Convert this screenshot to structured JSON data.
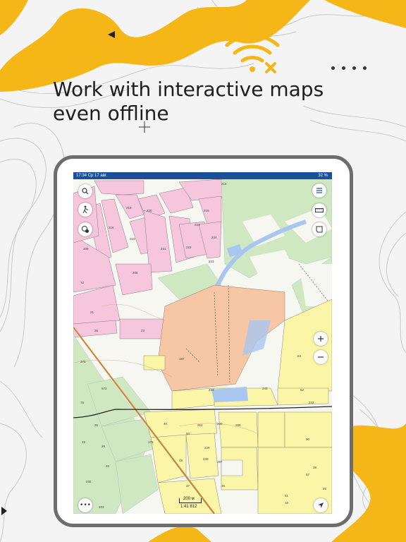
{
  "headline": {
    "line1": "Work with interactive maps",
    "line2": "even offline"
  },
  "status": {
    "time_date": "17:34  Ср 17 авг.",
    "battery": "32 %"
  },
  "map": {
    "scale_label": "200 м",
    "scale_ratio": "1:41 812",
    "parcel_labels": [
      "214",
      "218",
      "220",
      "215",
      "216",
      "223",
      "224",
      "222",
      "221",
      "209",
      "72",
      "21",
      "26",
      "23",
      "208",
      "243",
      "244",
      "62",
      "245",
      "63",
      "34",
      "510",
      "40",
      "45",
      "251",
      "200",
      "205",
      "206",
      "229",
      "230",
      "48",
      "22",
      "176",
      "232",
      "37",
      "36",
      "103",
      "10",
      "58",
      "57",
      "56",
      "51",
      "23"
    ]
  },
  "colors": {
    "brand_yellow": "#f5b617",
    "statusbar": "#1b4f98",
    "pink": "#f5c6dc",
    "green": "#c9eac0",
    "orange": "#f7c6a4",
    "yellow": "#fbf5a8"
  },
  "icons": [
    "search-icon",
    "hiker-icon",
    "layers-icon",
    "menu-icon",
    "ruler-icon",
    "bookmark-icon",
    "zoom-in-icon",
    "zoom-out-icon",
    "more-icon",
    "navigation-icon",
    "wifi-off-icon"
  ]
}
